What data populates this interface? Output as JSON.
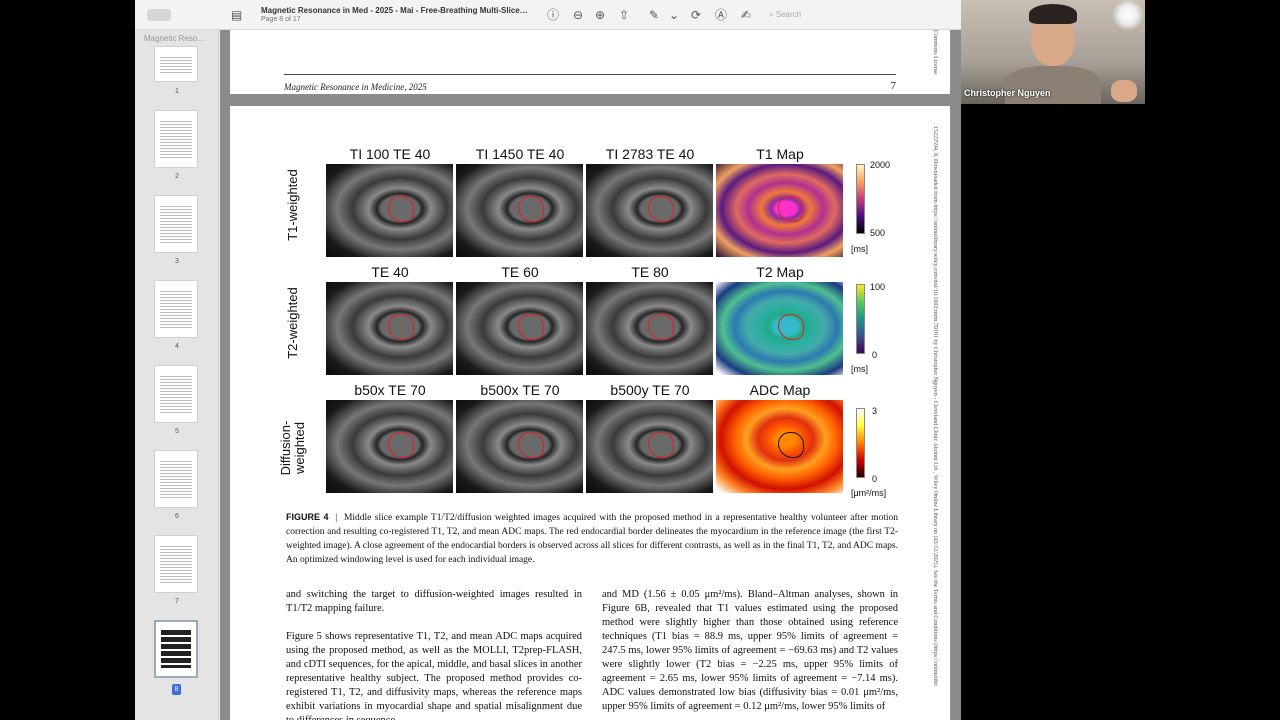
{
  "window": {
    "title": "Magnetic Resonance in Med - 2025 - Mai - Free-Breathing Multi-Slice…",
    "subtitle": "Page 8 of 17",
    "search_placeholder": "Search"
  },
  "sidebar": {
    "header": "Magnetic Reso…",
    "pages": [
      "1",
      "2",
      "3",
      "4",
      "5",
      "6",
      "7",
      "8"
    ],
    "selected": "8"
  },
  "page_header": {
    "journal": "Magnetic Resonance in Medicine, 2025",
    "page_number": "7"
  },
  "side_text": {
    "top": "Commons License",
    "main": "15222594, 0, Downloaded from https://onlinelibrary.wiley.com/doi/10.1002/mrm.70181 by Christopher Nguyen - Cleveland Clinic Alumni Lib , Wiley Online Library on [03/12/2025]. See the Terms and Conditions (https://onlinelibrary.wiley.com/terms-and-conditions) on Wiley Online Library for rules of use; OA articles are governed by the applicable Creative Commons License"
  },
  "figure": {
    "rows": [
      {
        "label": "T1-weighted",
        "cols": [
          "TI 100 TE 40",
          "TI 1450 TE 40",
          "TI 2783 TE 40",
          "T1 Map"
        ],
        "cbar_max": "2000",
        "cbar_min": "500",
        "unit": "[ms]"
      },
      {
        "label": "T2-weighted",
        "cols": [
          "TE 40",
          "TE 60",
          "TE 80",
          "T2 Map"
        ],
        "cbar_max": "100",
        "cbar_min": "0",
        "unit": "[ms]"
      },
      {
        "label": "Diffusion-weighted",
        "cols": [
          "b50x TE 70",
          "b500x TE 70",
          "b500y TE 70",
          "ADC Map"
        ],
        "cbar_max": "3",
        "cbar_min": "0",
        "unit": "[μm²/ms]"
      }
    ],
    "caption_label": "FIGURE 4",
    "caption_text": "Middle slice example T1/T2/diffusion weighted images acquired with the proposed method in a representative healthy volunteer after motion correction and resulting co-registered T1, T2, and mean ADC maps. The red endocardial border delineates the myocardium in the reference image (the first T2-weighted image). A close agreement of the endocardial borders is observed across all slices for different contrasts, as well as in the final T1, T2, and ADC maps. An optimized windowing level is used for each individual image."
  },
  "body": {
    "left_p1": "and switching the target to diffusion-weighted images resulted in T1/T2 mapping failure.",
    "left_p2": "Figure 5 shows representative T1, T2, and mean ADC maps acquired using the proposed method, as well as the MOLLI, T2prep-FLASH, and cDTI sequences, for the apical, middle, and basal slices in another representative healthy subject. The proposed method provides co-registered T1, T2, and diffusivity maps, whereas the reference maps exhibit variations in myocardial shape and spatial misalignment due to differences in sequence",
    "right_p1": "and MD (1.56 ± 0.05 μm²/ms). Bland–Altman analyses, shown in Figure 6B, revealed that T1 values estimated using the proposed method were slightly higher than those obtained using reference techniques (T1 bias = 88.9 ms, upper 95% limits of agreement = 247.5 ms, lower 95% limits of agreement = −69.63 ms) and T2 values were slightly lower (T2 bias = −2.25 ms, upper 95% limits of agreement = 2.65 ms, lower 95% limits of agreement = −7.14 ms). ADC values demonstrated low bias (diffusivity bias = 0.01 μm²/ms, upper 95% limits of agreement = 0.12 μm²/ms, lower 95% limits of"
  },
  "webcam": {
    "name": "Christopher Nguyen"
  },
  "icons": {
    "info": "ⓘ",
    "zoom_out": "⊖",
    "zoom_in": "⊕",
    "share": "⇧",
    "pen": "✎",
    "chevron": "⌄",
    "rotate": "⟳",
    "markup": "Ⓐ",
    "sign": "✍",
    "search": "⌕"
  }
}
